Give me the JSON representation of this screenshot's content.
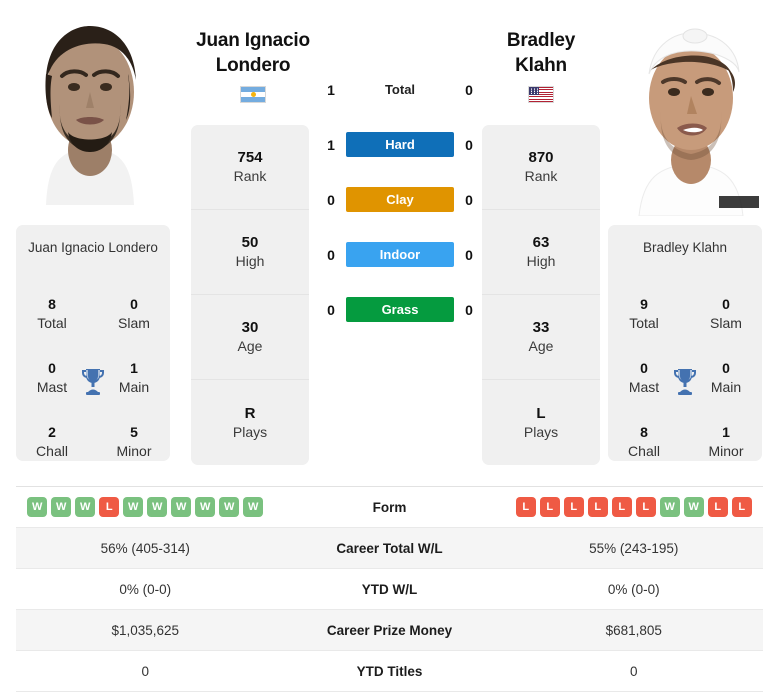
{
  "players": {
    "left": {
      "name": "Juan Ignacio Londero",
      "name_line1": "Juan Ignacio",
      "name_line2": "Londero",
      "country": "Argentina",
      "flag_icon": "flag-argentina-icon",
      "photo_alt": "Juan Ignacio Londero headshot",
      "rank": "754",
      "rank_label": "Rank",
      "high": "50",
      "high_label": "High",
      "age": "30",
      "age_label": "Age",
      "plays": "R",
      "plays_label": "Plays",
      "titles": {
        "total": "8",
        "total_label": "Total",
        "slam": "0",
        "slam_label": "Slam",
        "mast": "0",
        "mast_label": "Mast",
        "main": "1",
        "main_label": "Main",
        "chall": "2",
        "chall_label": "Chall",
        "minor": "5",
        "minor_label": "Minor"
      },
      "form": [
        "W",
        "W",
        "W",
        "L",
        "W",
        "W",
        "W",
        "W",
        "W",
        "W"
      ],
      "career_total_wl": "56% (405-314)",
      "ytd_wl": "0% (0-0)",
      "career_prize_money": "$1,035,625",
      "ytd_titles": "0"
    },
    "right": {
      "name": "Bradley Klahn",
      "name_line1": "Bradley",
      "name_line2": "Klahn",
      "country": "United States",
      "flag_icon": "flag-usa-icon",
      "photo_alt": "Bradley Klahn headshot",
      "rank": "870",
      "rank_label": "Rank",
      "high": "63",
      "high_label": "High",
      "age": "33",
      "age_label": "Age",
      "plays": "L",
      "plays_label": "Plays",
      "titles": {
        "total": "9",
        "total_label": "Total",
        "slam": "0",
        "slam_label": "Slam",
        "mast": "0",
        "mast_label": "Mast",
        "main": "0",
        "main_label": "Main",
        "chall": "8",
        "chall_label": "Chall",
        "minor": "1",
        "minor_label": "Minor"
      },
      "form": [
        "L",
        "L",
        "L",
        "L",
        "L",
        "L",
        "W",
        "W",
        "L",
        "L"
      ],
      "career_total_wl": "55% (243-195)",
      "ytd_wl": "0% (0-0)",
      "career_prize_money": "$681,805",
      "ytd_titles": "0"
    }
  },
  "head_to_head": [
    {
      "label": "Total",
      "left": "1",
      "right": "0",
      "style": "plain",
      "color": ""
    },
    {
      "label": "Hard",
      "left": "1",
      "right": "0",
      "style": "pill",
      "color": "#0f6fb8"
    },
    {
      "label": "Clay",
      "left": "0",
      "right": "0",
      "style": "pill",
      "color": "#e09400"
    },
    {
      "label": "Indoor",
      "left": "0",
      "right": "0",
      "style": "pill",
      "color": "#39a3f0"
    },
    {
      "label": "Grass",
      "left": "0",
      "right": "0",
      "style": "pill",
      "color": "#059b3f"
    }
  ],
  "table_rows": [
    {
      "key": "form",
      "label": "Form",
      "type": "form"
    },
    {
      "key": "career_total_wl",
      "label": "Career Total W/L",
      "type": "text"
    },
    {
      "key": "ytd_wl",
      "label": "YTD W/L",
      "type": "text"
    },
    {
      "key": "career_prize_money",
      "label": "Career Prize Money",
      "type": "text"
    },
    {
      "key": "ytd_titles",
      "label": "YTD Titles",
      "type": "text"
    }
  ],
  "colors": {
    "card_bg": "#f0f0f0",
    "row_alt_bg": "#f5f5f5",
    "win_badge": "#7ac17f",
    "loss_badge": "#ef5a44",
    "trophy": "#4472b0"
  }
}
